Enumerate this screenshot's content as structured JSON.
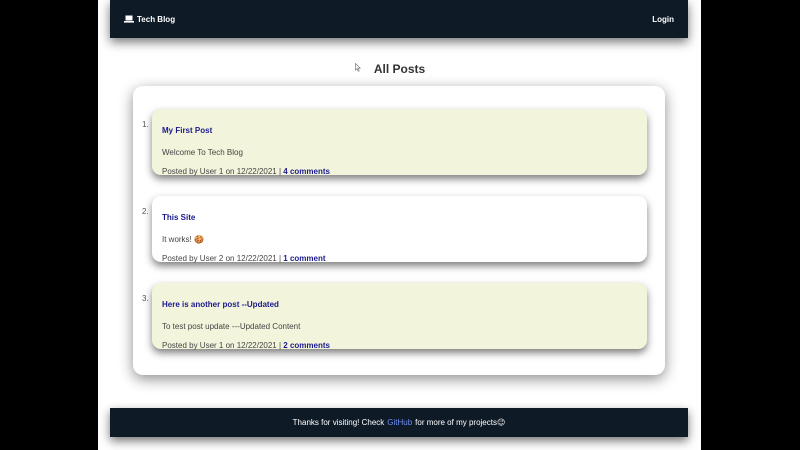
{
  "navbar": {
    "brand_icon": "laptop-icon",
    "brand_label": "Tech Blog",
    "login_label": "Login"
  },
  "page_title": "All Posts",
  "posts": [
    {
      "number": "1.",
      "title": "My First Post",
      "body": "Welcome To Tech Blog",
      "meta": "Posted by User 1 on 12/22/2021 |",
      "comments": "4 comments"
    },
    {
      "number": "2.",
      "title": "This Site",
      "body": "It works! 🍪",
      "meta": "Posted by User 2 on 12/22/2021 |",
      "comments": "1 comment"
    },
    {
      "number": "3.",
      "title": "Here is another post --Updated",
      "body": "To test post update ---Updated Content",
      "meta": "Posted by User 1 on 12/22/2021 |",
      "comments": "2 comments"
    }
  ],
  "footer": {
    "text_before": "Thanks for visiting! Check",
    "link_label": "GitHub",
    "text_after": "for more of my projects😉"
  },
  "colors": {
    "navbar_bg": "#0e1a26",
    "post_alt_bg": "#f3f4dc",
    "link": "#1a1a8c",
    "footer_link": "#6c8ef5"
  }
}
